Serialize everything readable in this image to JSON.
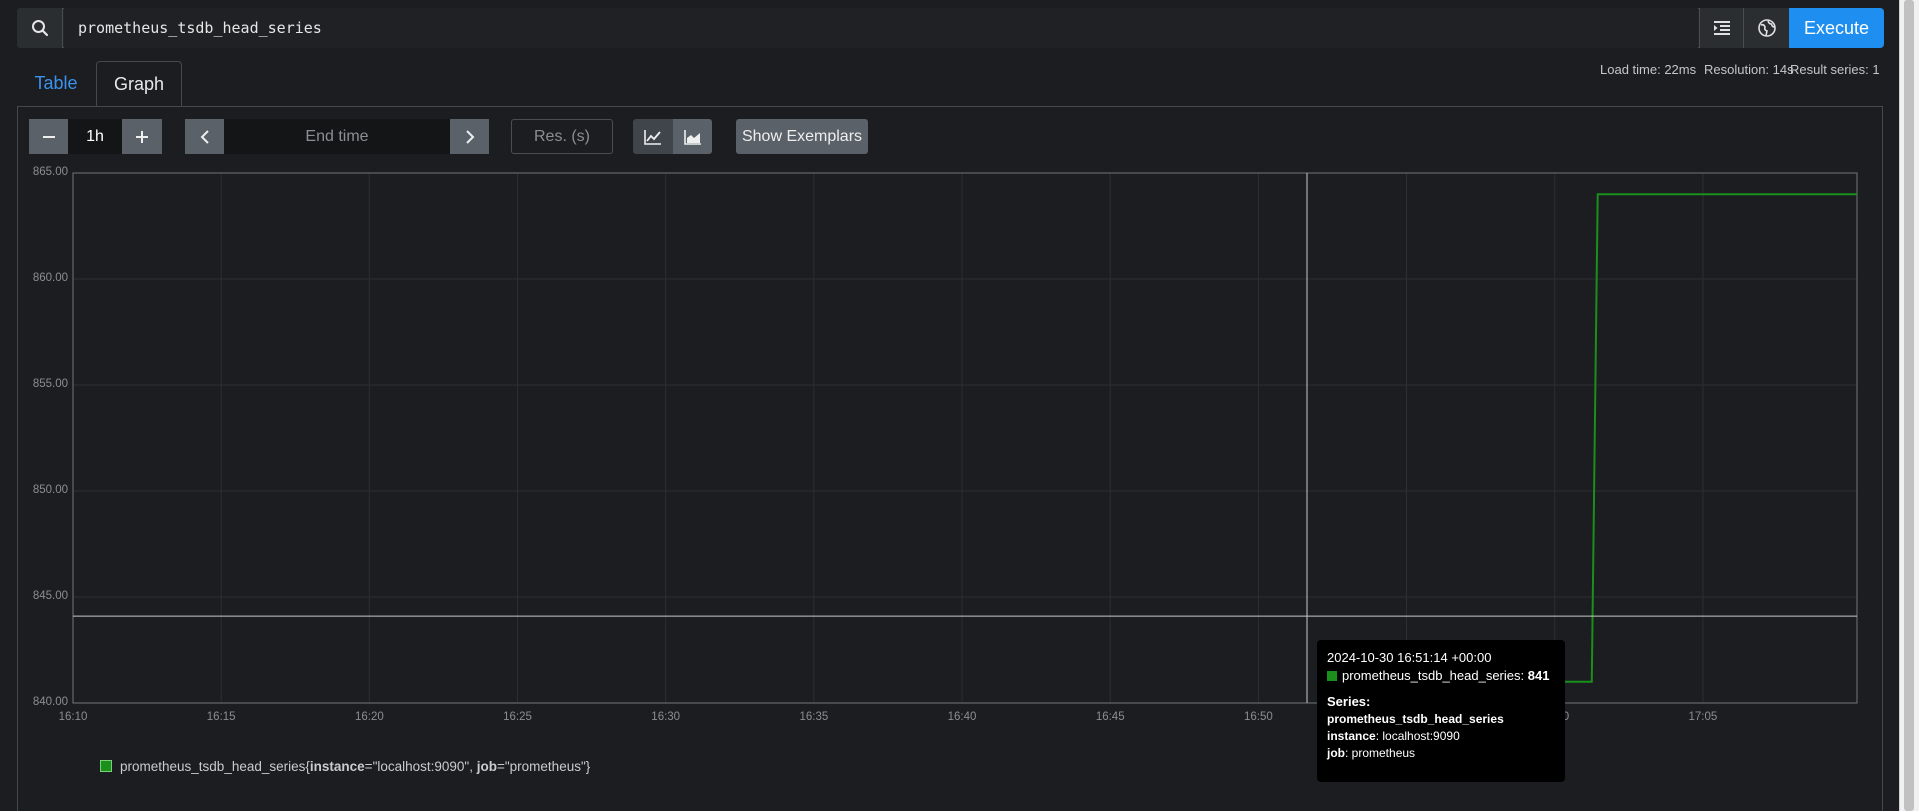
{
  "query": {
    "value": "prometheus_tsdb_head_series"
  },
  "toolbar": {
    "execute_label": "Execute"
  },
  "tabs": {
    "table": "Table",
    "graph": "Graph"
  },
  "meta": {
    "load_time": "Load time: 22ms",
    "resolution": "Resolution: 14s",
    "result_series": "Result series: 1"
  },
  "controls": {
    "range": "1h",
    "end_time_placeholder": "End time",
    "res_placeholder": "Res. (s)",
    "exemplars_label": "Show Exemplars"
  },
  "chart_data": {
    "type": "line",
    "x_ticks": [
      "16:10",
      "16:15",
      "16:20",
      "16:25",
      "16:30",
      "16:35",
      "16:40",
      "16:45",
      "16:50",
      "16:55",
      "17:00",
      "17:05"
    ],
    "y_ticks": [
      "865.00",
      "860.00",
      "855.00",
      "850.00",
      "845.00",
      "840.00"
    ],
    "ylim": [
      840,
      865
    ],
    "xlim_minutes": [
      0,
      60.2
    ],
    "series": [
      {
        "name": "prometheus_tsdb_head_series",
        "color": "#1a8f1a",
        "points": [
          [
            49.95,
            841
          ],
          [
            51.25,
            841
          ],
          [
            51.45,
            864
          ],
          [
            60.2,
            864
          ]
        ]
      }
    ],
    "crosshair": {
      "x_minutes": 41.23,
      "y": 844.1
    },
    "grid": true
  },
  "tooltip": {
    "timestamp": "2024-10-30 16:51:14 +00:00",
    "series_name": "prometheus_tsdb_head_series",
    "value": "841",
    "series_heading": "Series:",
    "metric": "prometheus_tsdb_head_series",
    "instance_key": "instance",
    "instance_value": "localhost:9090",
    "job_key": "job",
    "job_value": "prometheus"
  },
  "legend": {
    "metric": "prometheus_tsdb_head_series",
    "instance_key": "instance",
    "instance_value": "\"localhost:9090\"",
    "job_key": "job",
    "job_value": "\"prometheus\""
  }
}
